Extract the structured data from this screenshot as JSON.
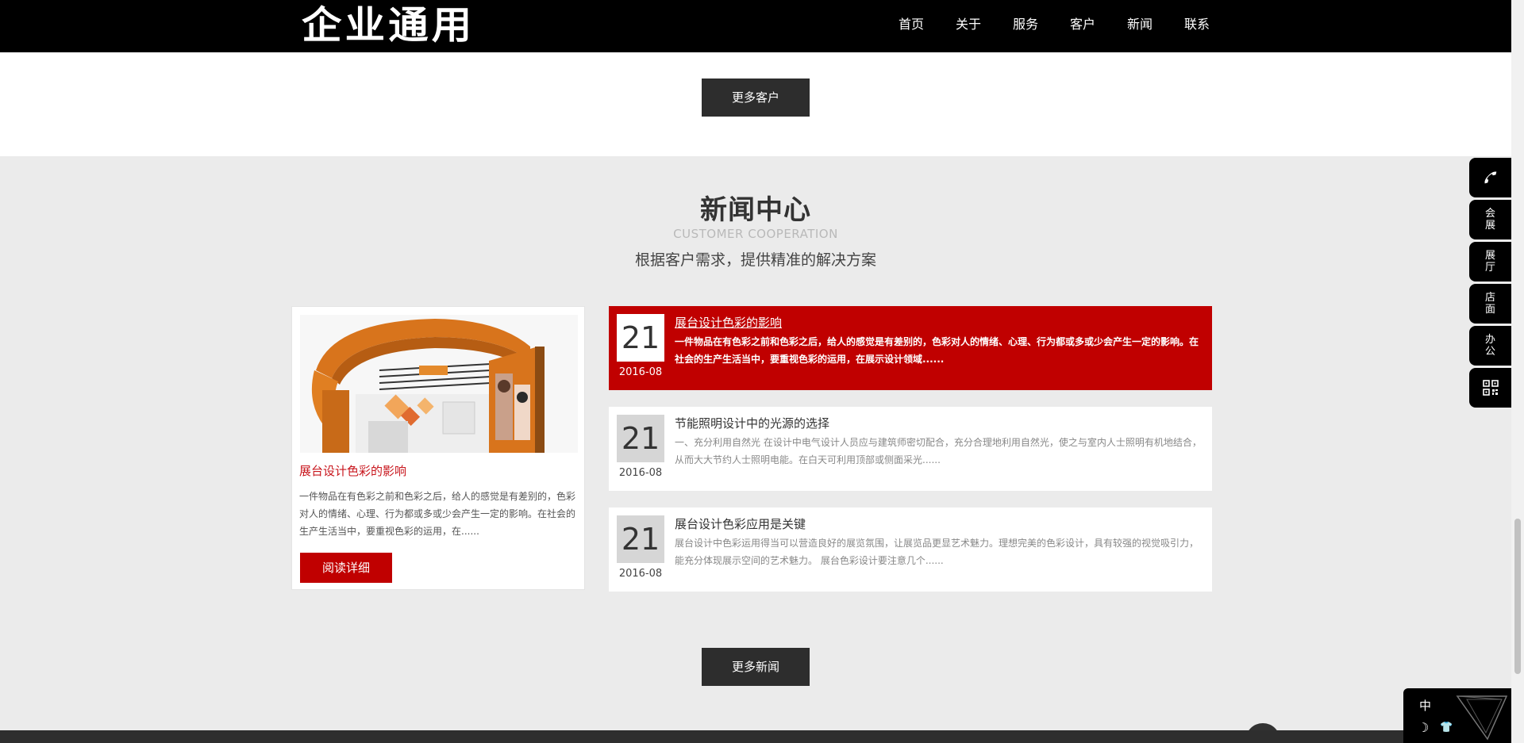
{
  "header": {
    "logo": "企业通用",
    "nav": [
      "首页",
      "关于",
      "服务",
      "客户",
      "新闻",
      "联系"
    ]
  },
  "customers": {
    "more_label": "更多客户"
  },
  "news": {
    "title": "新闻中心",
    "subtitle_en": "CUSTOMER COOPERATION",
    "subtitle_cn": "根据客户需求，提供精准的解决方案",
    "featured": {
      "title": "展台设计色彩的影响",
      "desc": "一件物品在有色彩之前和色彩之后，给人的感觉是有差别的，色彩对人的情绪、心理、行为都或多或少会产生一定的影响。在社会的生产生活当中，要重视色彩的运用，在......",
      "button": "阅读详细"
    },
    "items": [
      {
        "day": "21",
        "ym": "2016-08",
        "title": "展台设计色彩的影响",
        "excerpt": "一件物品在有色彩之前和色彩之后，给人的感觉是有差别的，色彩对人的情绪、心理、行为都或多或少会产生一定的影响。在社会的生产生活当中，要重视色彩的运用，在展示设计领域......"
      },
      {
        "day": "21",
        "ym": "2016-08",
        "title": "节能照明设计中的光源的选择",
        "excerpt": "一、充分利用自然光 在设计中电气设计人员应与建筑师密切配合，充分合理地利用自然光，使之与室内人士照明有机地结合，从而大大节约人士照明电能。在白天可利用顶部或侧面采光......"
      },
      {
        "day": "21",
        "ym": "2016-08",
        "title": "展台设计色彩应用是关键",
        "excerpt": "展台设计中色彩运用得当可以营造良好的展览氛围，让展览品更显艺术魅力。理想完美的色彩设计，具有较强的视觉吸引力，能充分体现展示空间的艺术魅力。 展台色彩设计要注意几个......"
      }
    ],
    "more_label": "更多新闻"
  },
  "sidebar": {
    "items": [
      {
        "icon": "phone-icon",
        "label": ""
      },
      {
        "label": "会展"
      },
      {
        "label": "展厅"
      },
      {
        "label": "店面"
      },
      {
        "label": "办公"
      },
      {
        "icon": "qrcode-icon",
        "label": ""
      }
    ]
  },
  "widget": {
    "lang": "中"
  }
}
